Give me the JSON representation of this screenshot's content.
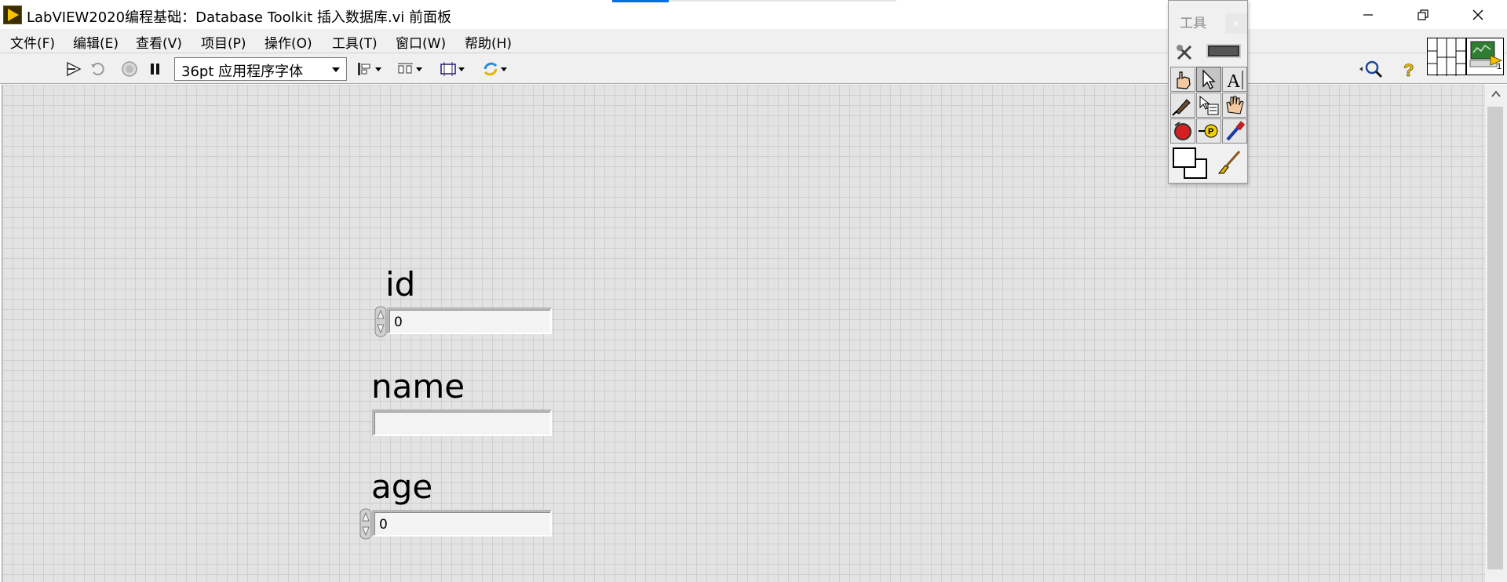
{
  "window": {
    "title": "LabVIEW2020编程基础：Database Toolkit 插入数据库.vi 前面板",
    "minimize_icon": "minimize-icon",
    "maximize_icon": "restore-icon",
    "close_icon": "close-icon"
  },
  "menu": {
    "items": [
      {
        "label": "文件(F)"
      },
      {
        "label": "编辑(E)"
      },
      {
        "label": "查看(V)"
      },
      {
        "label": "项目(P)"
      },
      {
        "label": "操作(O)"
      },
      {
        "label": "工具(T)"
      },
      {
        "label": "窗口(W)"
      },
      {
        "label": "帮助(H)"
      }
    ]
  },
  "toolbar": {
    "font_select_value": "36pt 应用程序字体",
    "icons": [
      "run-arrow-icon",
      "run-continuously-icon",
      "abort-icon",
      "pause-icon",
      "align-objects-icon",
      "distribute-objects-icon",
      "resize-objects-icon",
      "reorder-icon",
      "search-icon",
      "help-icon"
    ]
  },
  "tools_palette": {
    "title": "工具",
    "close_label": "×",
    "tools": [
      "auto-tool-icon",
      "automatic-selection-indicator",
      "operate-value-icon",
      "position-select-icon",
      "edit-text-icon",
      "connect-wire-icon",
      "shortcut-menu-icon",
      "scroll-window-icon",
      "breakpoint-icon",
      "probe-icon",
      "get-color-icon",
      "set-color-icon",
      "paintbrush-icon"
    ]
  },
  "front_panel": {
    "controls": [
      {
        "label": "id",
        "value": "0",
        "type": "numeric"
      },
      {
        "label": "name",
        "value": "",
        "type": "string"
      },
      {
        "label": "age",
        "value": "0",
        "type": "numeric"
      }
    ]
  },
  "connector": {
    "icon_number": "1"
  },
  "colors": {
    "accent_tab": "#0a6fd8",
    "canvas_grid": "#cfcfcf",
    "canvas_bg": "#e3e3e3",
    "abort_red": "#d42020",
    "help_yellow": "#f2c500"
  }
}
